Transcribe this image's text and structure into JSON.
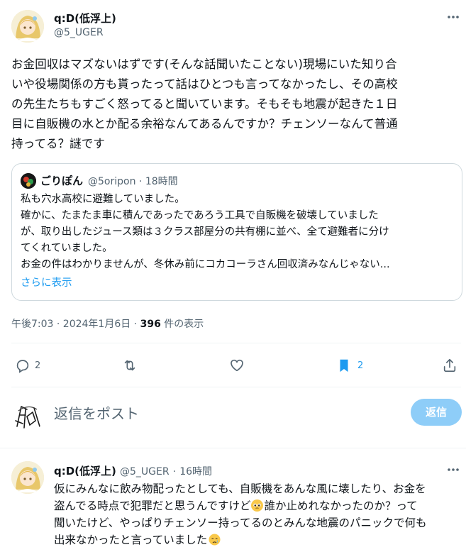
{
  "main_post": {
    "author_name": "q:D(低浮上)",
    "author_handle": "@5_UGER",
    "text": "お金回収はマズないはずです(そんな話聞いたことない)現場にいた知り合\nいや役場関係の方も貰ったって話はひとつも言ってなかったし、その高校\nの先生たちもすごく怒ってると聞いています。そもそも地震が起きた１日\n目に自販機の水とか配る余裕なんてあるんですか？チェンソーなんて普通\n持ってる？謎です"
  },
  "quoted_post": {
    "author_name": "ごりぽん",
    "author_handle": "@5oripon",
    "separator": "·",
    "time": "18時間",
    "text": "私も穴水高校に避難していました。\n確かに、たまたま車に積んであったであろう工具で自販機を破壊していました\nが、取り出したジュース類は３クラス部屋分の共有棚に並べ、全て避難者に分け\nてくれていました。\nお金の件はわかりませんが、冬休み前にコカコーラさん回収済みなんじゃない...",
    "show_more": "さらに表示"
  },
  "meta": {
    "timestamp": "午後7:03 · 2024年1月6日 ·",
    "views_count": "396",
    "views_label": "件の表示"
  },
  "actions": {
    "reply_count": "2",
    "retweet_count": "",
    "like_count": "",
    "bookmark_count": "2"
  },
  "compose": {
    "placeholder": "返信をポスト",
    "button_label": "返信"
  },
  "reply_post": {
    "author_name": "q:D(低浮上)",
    "author_handle": "@5_UGER",
    "separator": "·",
    "time": "16時間",
    "text_1": "仮にみんなに飲み物配ったとしても、自販機をあんな風に壊したり、お金を\n盗んでる時点で犯罪だと思うんですけど",
    "text_2": "誰か止めれなかったのか？って\n聞いたけど、やっぱりチェンソー持ってるのとみんな地震のパニックで何も\n出来なかったと言っていました"
  },
  "colors": {
    "accent": "#1d9bf0",
    "bookmark_active": "#1d9bf0",
    "reply_button": "#8ecdf8",
    "secondary_text": "#536471",
    "border": "#cfd9de"
  }
}
